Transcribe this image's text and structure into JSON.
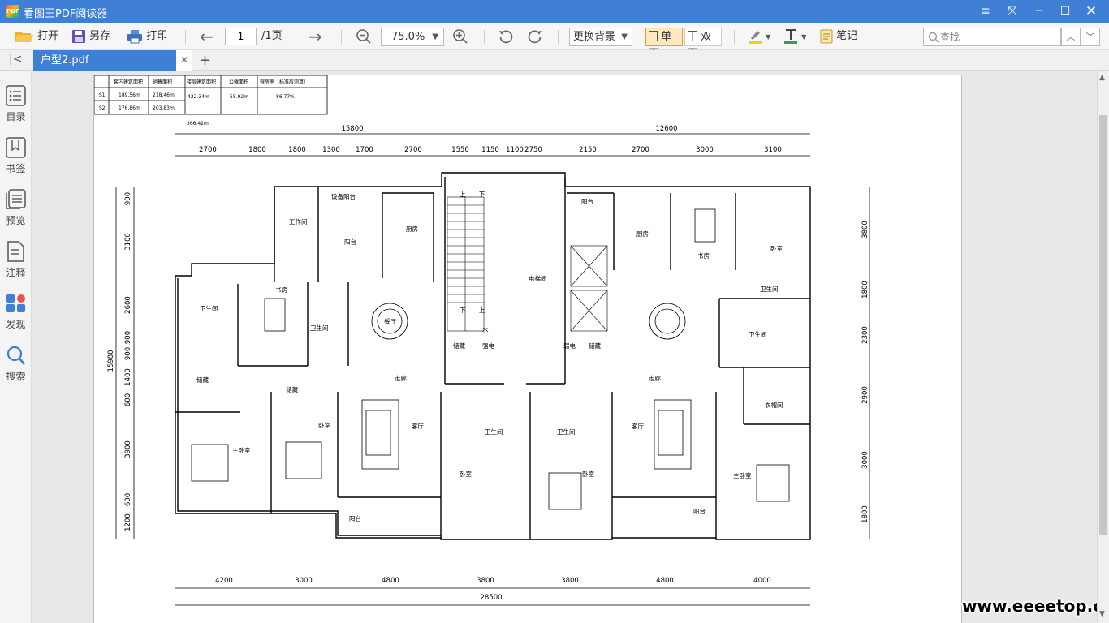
{
  "window": {
    "title": "看图王PDF阅读器",
    "logo_text": "PDF"
  },
  "toolbar": {
    "open": "打开",
    "save_as": "另存",
    "print": "打印",
    "page_input": "1",
    "page_total": "/1页",
    "zoom": "75.0%",
    "background": "更换背景",
    "single_page": "单页",
    "double_page": "双页",
    "notes": "笔记",
    "search_placeholder": "查找"
  },
  "tabs": [
    {
      "label": "户型2.pdf"
    }
  ],
  "sidebar": {
    "items": [
      {
        "label": "目录",
        "icon": "toc-icon"
      },
      {
        "label": "书签",
        "icon": "bookmark-icon"
      },
      {
        "label": "预览",
        "icon": "preview-icon"
      },
      {
        "label": "注释",
        "icon": "annotation-icon"
      },
      {
        "label": "发现",
        "icon": "discover-icon"
      },
      {
        "label": "搜索",
        "icon": "search-icon"
      }
    ]
  },
  "document": {
    "area_table": {
      "headers": [
        "套内建筑面积",
        "销售面积",
        "楼层建筑面积",
        "公摊面积",
        "得房率（标准层测算）"
      ],
      "rows": [
        {
          "id": "S1",
          "inner": "189.56m",
          "sales": "218.46m"
        },
        {
          "id": "S2",
          "inner": "176.86m",
          "sales": "203.83m"
        }
      ],
      "floor_area": "422.34m",
      "shared_area": "55.92m",
      "efficiency": "86.77%",
      "below_value": "366.42m"
    },
    "top_dims_total": [
      "15800",
      "12600"
    ],
    "top_dims": [
      "2700",
      "1800",
      "1800",
      "1300",
      "1700",
      "2700",
      "1550",
      "1150",
      "1100",
      "2750",
      "2150",
      "2700",
      "3000",
      "3100"
    ],
    "bottom_dims": [
      "4200",
      "3000",
      "4800",
      "3800",
      "3800",
      "4800",
      "4000"
    ],
    "bottom_total": "28500",
    "left_total": "15980",
    "left_dims": [
      "900",
      "3100",
      "2600",
      "900",
      "900",
      "1400",
      "600",
      "3900",
      "600",
      "1200"
    ],
    "right_dims": [
      "3800",
      "1800",
      "2300",
      "2900",
      "3000",
      "1800"
    ],
    "rooms": {
      "equipment_balcony": "设备阳台",
      "work_room": "工作间",
      "balcony": "阳台",
      "kitchen": "厨房",
      "study": "书房",
      "bathroom": "卫生间",
      "dining": "餐厅",
      "storage": "储藏",
      "corridor": "走廊",
      "bedroom": "卧室",
      "living": "客厅",
      "master_bedroom": "主卧室",
      "elevator_hall": "电梯间",
      "strong_elec": "强电",
      "weak_elec": "弱电",
      "water": "水",
      "up": "上",
      "down": "下",
      "cloakroom": "衣帽间"
    }
  },
  "watermark": "www.eeeetop.com",
  "colors": {
    "titlebar": "#3f7fd6",
    "accent": "#f5a623",
    "tab_active": "#3f7fd6"
  }
}
